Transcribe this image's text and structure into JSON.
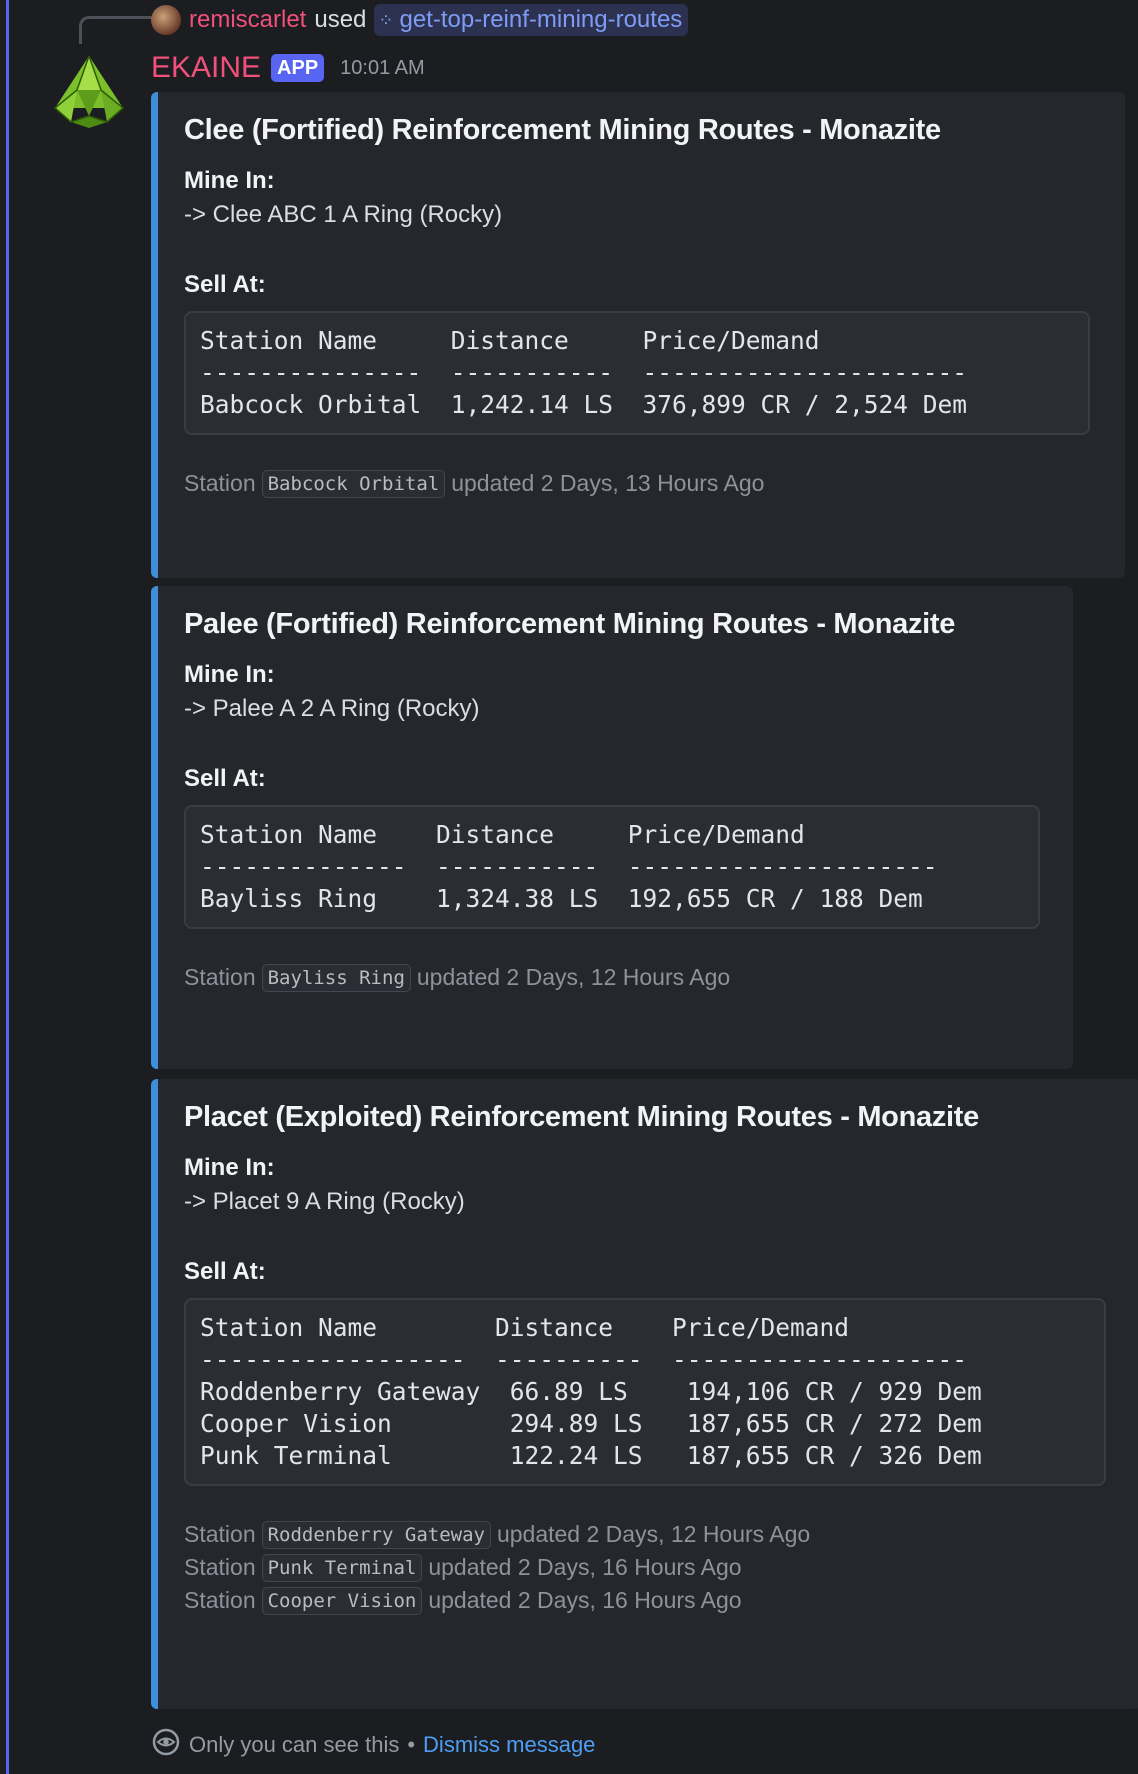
{
  "reply": {
    "user": "remiscarlet",
    "used": "used",
    "command": "get-top-reinf-mining-routes"
  },
  "bot": {
    "name": "EKAINE",
    "badge": "APP",
    "timestamp": "10:01 AM"
  },
  "embeds": [
    {
      "title": "Clee (Fortified) Reinforcement Mining Routes - Monazite",
      "mine_label": "Mine In:",
      "mine_value": "-> Clee ABC 1 A Ring (Rocky)",
      "sell_label": "Sell At:",
      "table_header": "Station Name     Distance     Price/Demand",
      "table_rule": "---------------  -----------  ----------------------",
      "table_rows": [
        "Babcock Orbital  1,242.14 LS  376,899 CR / 2,524 Dem"
      ],
      "footer": [
        {
          "prefix": "Station",
          "station": "Babcock Orbital",
          "suffix": "updated 2 Days, 13 Hours Ago"
        }
      ]
    },
    {
      "title": "Palee (Fortified) Reinforcement Mining Routes - Monazite",
      "mine_label": "Mine In:",
      "mine_value": "-> Palee A 2 A Ring (Rocky)",
      "sell_label": "Sell At:",
      "table_header": "Station Name    Distance     Price/Demand",
      "table_rule": "--------------  -----------  ---------------------",
      "table_rows": [
        "Bayliss Ring    1,324.38 LS  192,655 CR / 188 Dem"
      ],
      "footer": [
        {
          "prefix": "Station",
          "station": "Bayliss Ring",
          "suffix": "updated 2 Days, 12 Hours Ago"
        }
      ]
    },
    {
      "title": "Placet (Exploited) Reinforcement Mining Routes - Monazite",
      "mine_label": "Mine In:",
      "mine_value": "-> Placet 9 A Ring (Rocky)",
      "sell_label": "Sell At:",
      "table_header": "Station Name        Distance    Price/Demand",
      "table_rule": "------------------  ----------  --------------------",
      "table_rows": [
        "Roddenberry Gateway  66.89 LS    194,106 CR / 929 Dem",
        "Cooper Vision        294.89 LS   187,655 CR / 272 Dem",
        "Punk Terminal        122.24 LS   187,655 CR / 326 Dem"
      ],
      "footer": [
        {
          "prefix": "Station",
          "station": "Roddenberry Gateway",
          "suffix": "updated 2 Days, 12 Hours Ago"
        },
        {
          "prefix": "Station",
          "station": "Punk Terminal",
          "suffix": "updated 2 Days, 16 Hours Ago"
        },
        {
          "prefix": "Station",
          "station": "Cooper Vision",
          "suffix": "updated 2 Days, 16 Hours Ago"
        }
      ]
    }
  ],
  "ephemeral": {
    "text": "Only you can see this",
    "separator": "•",
    "dismiss": "Dismiss message"
  },
  "colors": {
    "accent_border": "#3e8ed9",
    "username": "#f0507a",
    "app_badge": "#5865f2",
    "link": "#4d9ef4"
  },
  "icons": {
    "reply_avatar": "user-avatar-icon",
    "command": "slash-command-icon",
    "bot_avatar": "ekaine-logo-icon",
    "ephemeral": "eye-icon"
  }
}
